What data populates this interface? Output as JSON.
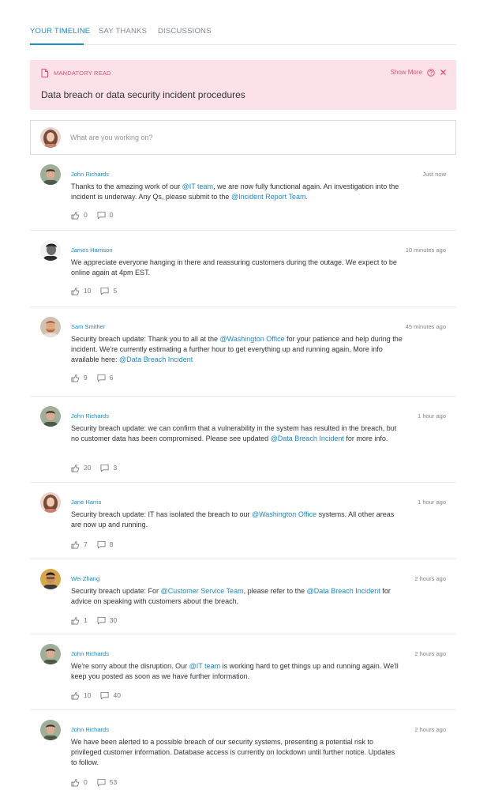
{
  "tabs": [
    {
      "label": "YOUR TIMELINE",
      "active": true
    },
    {
      "label": "SAY THANKS",
      "active": false
    },
    {
      "label": "DISCUSSIONS",
      "active": false
    }
  ],
  "banner": {
    "tag": "MANDATORY READ",
    "show_more": "Show More",
    "title": "Data breach or data security incident procedures",
    "icons": [
      "document-icon",
      "help-icon",
      "close-icon"
    ],
    "background": "#fce1e9",
    "accent": "#e0517a"
  },
  "composer": {
    "placeholder": "What are you working on?"
  },
  "colors": {
    "link": "#1e88c7",
    "text": "#2e3338",
    "muted": "#7d868d"
  },
  "posts": [
    {
      "author": "John Richards",
      "time": "Just now",
      "body": [
        {
          "t": "Thanks to the amazing work of our "
        },
        {
          "t": "@IT team",
          "m": true
        },
        {
          "t": ", we are now fully functional again. An investigation into the incident is underway. Any Qs, please submit to the "
        },
        {
          "t": "@Incident Report Team",
          "m": true
        },
        {
          "t": "."
        }
      ],
      "likes": "0",
      "comments": "0"
    },
    {
      "author": "James Harrison",
      "time": "10 minutes ago",
      "body": [
        {
          "t": "We appreciate everyone hanging in there and reassuring customers during the outage. We expect to be online again at 4pm EST."
        }
      ],
      "likes": "10",
      "comments": "5"
    },
    {
      "author": "Sam Smither",
      "time": "45 minutes ago",
      "body": [
        {
          "t": "Security breach update: Thank you to all at the "
        },
        {
          "t": "@Washington Office",
          "m": true
        },
        {
          "t": " for your patience and help during the incident. We're currently estimating a further hour to get everything up and running again. More info available here: "
        },
        {
          "t": "@Data Breach Incident",
          "m": true
        }
      ],
      "likes": "9",
      "comments": "6"
    },
    {
      "author": "John Richards",
      "time": "1 hour ago",
      "body": [
        {
          "t": "Security breach update: we can confirm that a vulnerability in the system has resulted in the breach, but no customer data has been compromised. Please see updated "
        },
        {
          "t": "@Data Breach Incident",
          "m": true
        },
        {
          "t": " for more info."
        }
      ],
      "likes": "20",
      "comments": "3"
    },
    {
      "author": "Jane Harris",
      "time": "1 hour ago",
      "body": [
        {
          "t": "Security breach update: IT has isolated the breach to our "
        },
        {
          "t": "@Washington Office",
          "m": true
        },
        {
          "t": " systems. All other areas are now up and running."
        }
      ],
      "likes": "7",
      "comments": "8"
    },
    {
      "author": "Wei Zhang",
      "time": "2 hours ago",
      "body": [
        {
          "t": "Security breach update: For "
        },
        {
          "t": "@Customer Service Team",
          "m": true
        },
        {
          "t": ", please refer to the "
        },
        {
          "t": "@Data Breach Incident",
          "m": true
        },
        {
          "t": " for advice on speaking with customers about the breach."
        }
      ],
      "likes": "1",
      "comments": "30"
    },
    {
      "author": "John Richards",
      "time": "2 hours ago",
      "body": [
        {
          "t": "We're sorry about the disruption. Our "
        },
        {
          "t": "@IT team",
          "m": true
        },
        {
          "t": " is working hard to get things up and running again. We'll keep you posted as soon as we have further information."
        }
      ],
      "likes": "10",
      "comments": "40"
    },
    {
      "author": "John Richards",
      "time": "2 hours ago",
      "body": [
        {
          "t": "We have been alerted to a possible breach of our security systems, presenting a potential risk to privileged customer information. Database access is currently on lockdown until further notice. Updates to follow."
        }
      ],
      "likes": "0",
      "comments": "53"
    }
  ]
}
